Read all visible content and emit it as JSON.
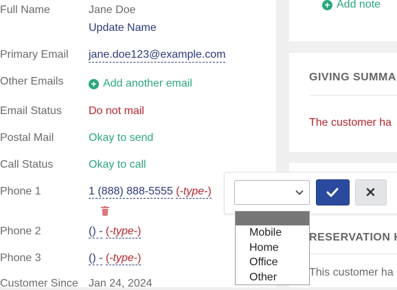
{
  "profile": {
    "full_name_label": "Full Name",
    "full_name_value": "Jane Doe",
    "update_name_link": "Update Name",
    "primary_email_label": "Primary Email",
    "primary_email_value": "jane.doe123@example.com",
    "other_emails_label": "Other Emails",
    "add_email_link": "Add another email",
    "email_status_label": "Email Status",
    "email_status_value": "Do not mail",
    "postal_mail_label": "Postal Mail",
    "postal_mail_value": "Okay to send",
    "call_status_label": "Call Status",
    "call_status_value": "Okay to call",
    "phone1_label": "Phone 1",
    "phone1_value": "1 (888) 888-5555",
    "phone1_type": "-type-",
    "phone2_label": "Phone 2",
    "phone2_value": "() -",
    "phone2_type": "-type-",
    "phone3_label": "Phone 3",
    "phone3_value": "() -",
    "phone3_type": "-type-",
    "customer_since_label": "Customer Since",
    "customer_since_value": "Jan 24, 2024"
  },
  "notes": {
    "add_note_link": "Add note"
  },
  "giving_summary": {
    "title": "GIVING SUMMA",
    "message": "The customer ha"
  },
  "reservation": {
    "title": "RESERVATION H",
    "message": "This customer ha"
  },
  "phone_type_editor": {
    "select_value": "",
    "options": [
      "Mobile",
      "Home",
      "Office",
      "Other"
    ]
  },
  "icons": {
    "add": "plus-circle-icon",
    "trash": "trash-icon",
    "confirm": "checkmark-icon",
    "cancel": "close-icon",
    "dropdown": "chevron-down-icon"
  },
  "colors": {
    "link_navy": "#2b3a7a",
    "status_red": "#b3262d",
    "status_green": "#2aa77a",
    "primary_button": "#2a4a9e"
  }
}
